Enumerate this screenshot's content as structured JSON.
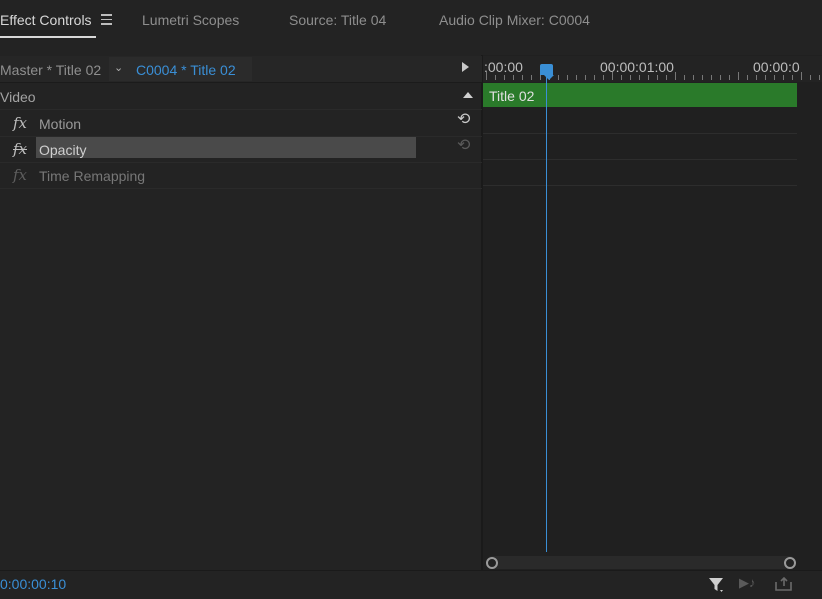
{
  "tabs": [
    {
      "label": "Effect Controls",
      "active": true
    },
    {
      "label": "Lumetri Scopes"
    },
    {
      "label": "Source: Title 04"
    },
    {
      "label": "Audio Clip Mixer: C0004"
    }
  ],
  "clip_header": {
    "master": "Master * Title 02",
    "clip": "C0004 * Title 02"
  },
  "effects": {
    "section": "Video",
    "items": [
      {
        "label": "Motion",
        "icon": "fx-icon",
        "has_reset": true
      },
      {
        "label": "Opacity",
        "icon": "fx-toggle-icon",
        "selected": true,
        "has_reset": true
      },
      {
        "label": "Time Remapping",
        "icon": "fx-icon-disabled"
      }
    ],
    "fx_glyph": "fx",
    "reset_glyph": "⟲"
  },
  "timeline": {
    "timecodes": [
      ":00:00",
      "00:00:01:00",
      "00:00:0"
    ],
    "clip_label": "Title 02",
    "clip_color": "#2a7a2a"
  },
  "footer": {
    "timecode": "0:00:00:10",
    "audio_glyph": "▶♪"
  },
  "colors": {
    "accent": "#3a8fd6",
    "background": "#232323"
  }
}
